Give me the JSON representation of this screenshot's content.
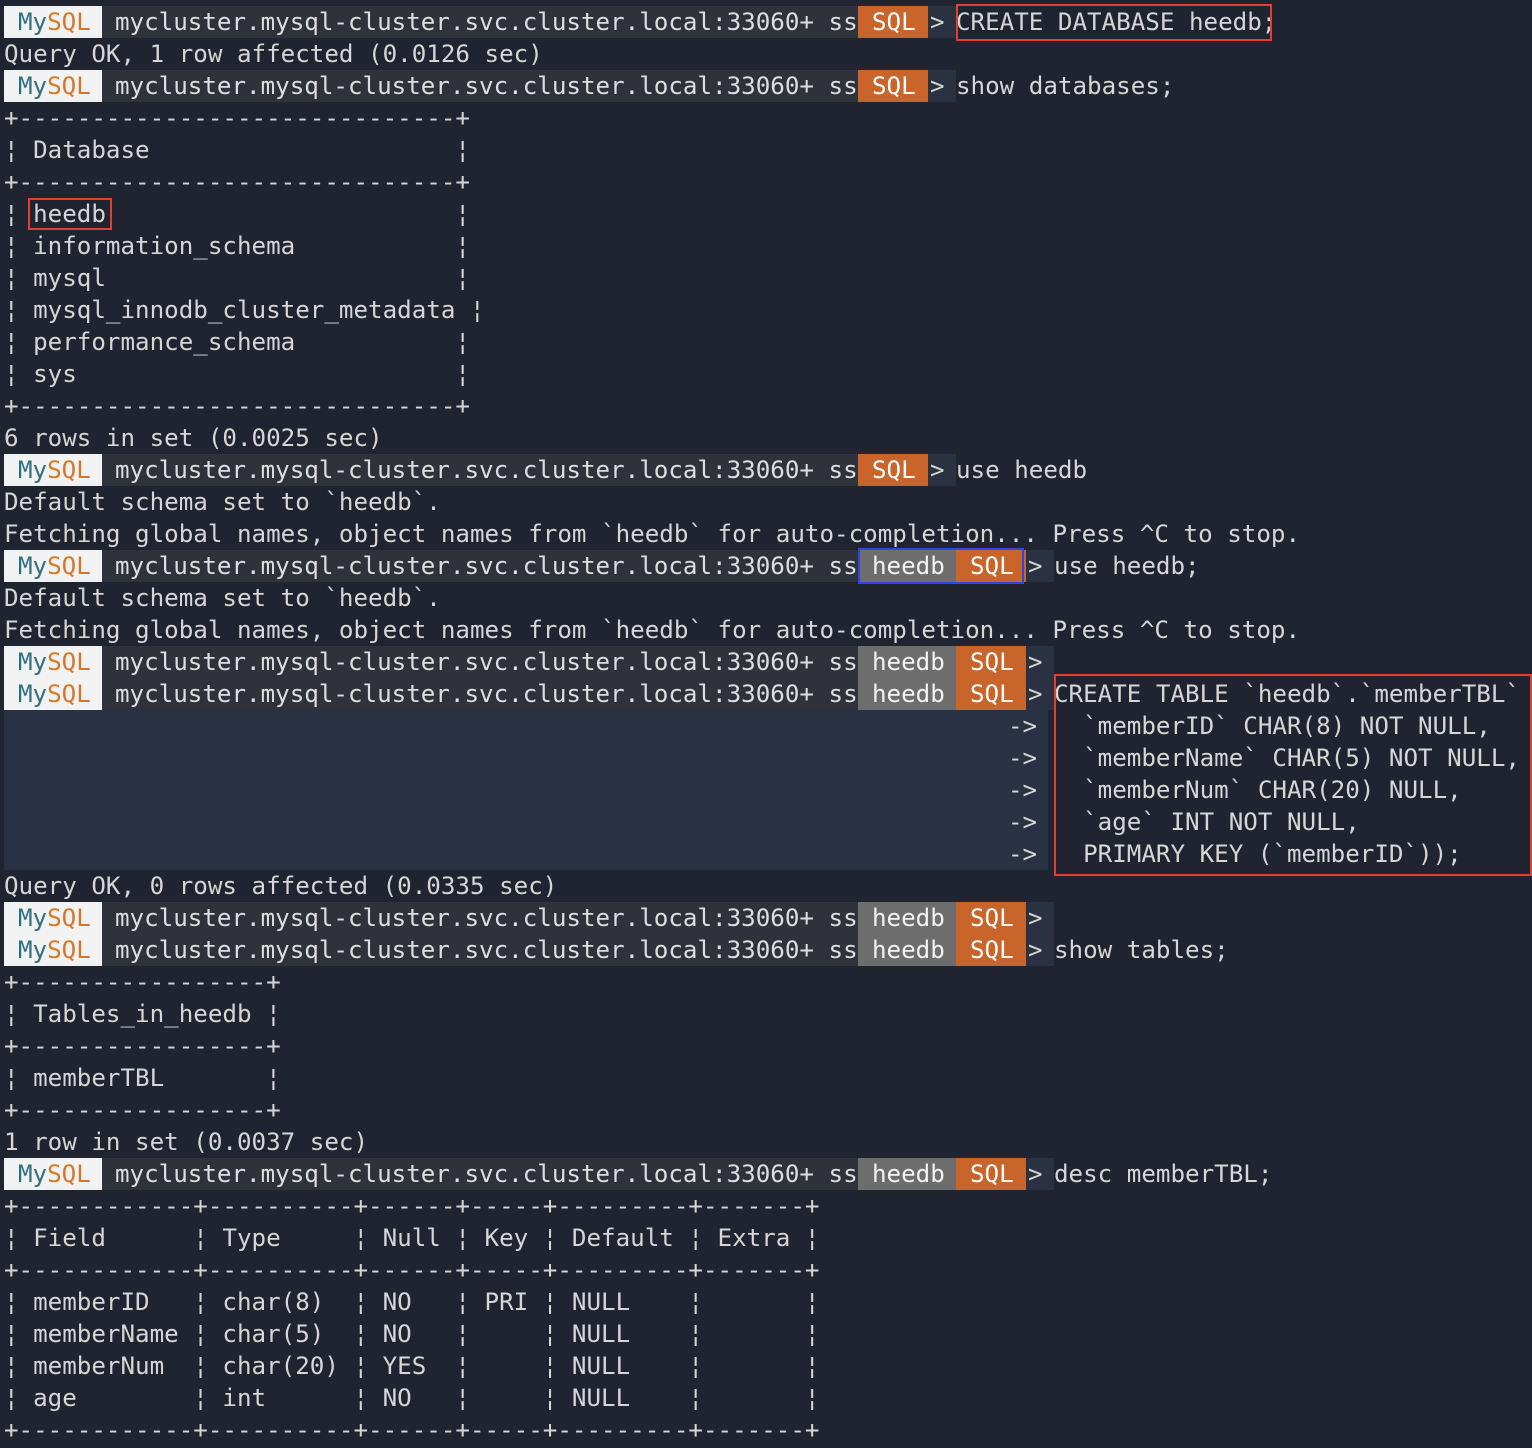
{
  "prompt": {
    "app": "My",
    "app_accent": "SQL",
    "host": "mycluster.mysql-cluster.svc.cluster.local:33060+ ssl",
    "schema": "heedb",
    "mode": "SQL",
    "arrow": ">",
    "continuation": "->"
  },
  "colors": {
    "background": "#1f2430",
    "prompt_mysql_bg": "#f2f2f2",
    "prompt_host_bg": "#2f323a",
    "prompt_schema_bg": "#6d6d6d",
    "prompt_sql_bg": "#c9642a",
    "highlight_red": "#e0412f",
    "highlight_blue": "#2e46e8"
  },
  "commands": {
    "create_db": "CREATE DATABASE heedb;",
    "show_databases": "show databases;",
    "use_heedb": "use heedb",
    "use_heedb_semicolon": "use heedb;",
    "create_table": [
      "CREATE TABLE `heedb`.`memberTBL` (",
      "  `memberID` CHAR(8) NOT NULL,",
      "  `memberName` CHAR(5) NOT NULL,",
      "  `memberNum` CHAR(20) NULL,",
      "  `age` INT NOT NULL,",
      "  PRIMARY KEY (`memberID`));"
    ],
    "show_tables": "show tables;",
    "desc_table": "desc memberTBL;"
  },
  "output": {
    "create_db_ok": "Query OK, 1 row affected (0.0126 sec)",
    "db_rows_footer": "6 rows in set (0.0025 sec)",
    "schema_set": "Default schema set to `heedb`.",
    "fetching": "Fetching global names, object names from `heedb` for auto-completion... Press ^C to stop.",
    "create_table_ok": "Query OK, 0 rows affected (0.0335 sec)",
    "tables_footer": "1 row in set (0.0037 sec)"
  },
  "databases_table": {
    "border": "+------------------------------+",
    "header": "¦ Database                     ¦",
    "first_row_value": "heedb",
    "rows": [
      "¦ heedb                        ¦",
      "¦ information_schema           ¦",
      "¦ mysql                        ¦",
      "¦ mysql_innodb_cluster_metadata ¦",
      "¦ performance_schema           ¦",
      "¦ sys                          ¦"
    ]
  },
  "tables_table": {
    "border": "+-----------------+",
    "header": "¦ Tables_in_heedb ¦",
    "rows": [
      "¦ memberTBL       ¦"
    ]
  },
  "desc_table": {
    "border": "+------------+----------+------+-----+---------+-------+",
    "header": "¦ Field      ¦ Type     ¦ Null ¦ Key ¦ Default ¦ Extra ¦",
    "rows": [
      "¦ memberID   ¦ char(8)  ¦ NO   ¦ PRI ¦ NULL    ¦       ¦",
      "¦ memberName ¦ char(5)  ¦ NO   ¦     ¦ NULL    ¦       ¦",
      "¦ memberNum  ¦ char(20) ¦ YES  ¦     ¦ NULL    ¦       ¦",
      "¦ age        ¦ int      ¦ NO   ¦     ¦ NULL    ¦       ¦"
    ]
  }
}
